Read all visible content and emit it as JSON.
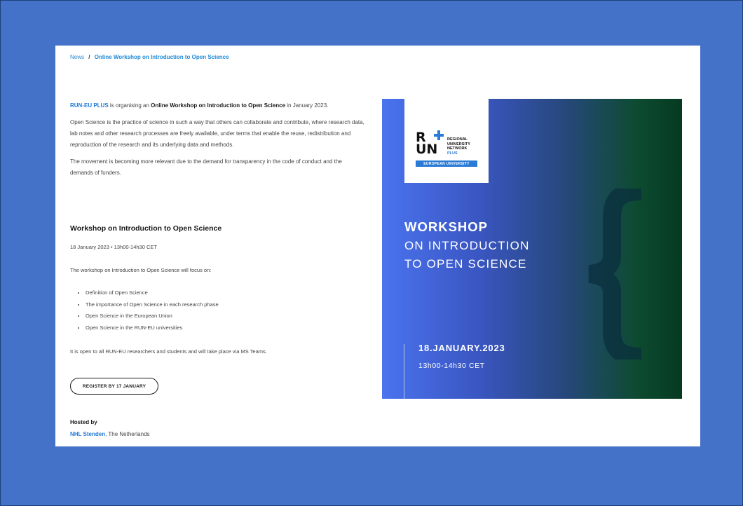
{
  "breadcrumb": {
    "parent": "News",
    "separator": "/",
    "current": "Online Workshop on Introduction to Open Science"
  },
  "intro": {
    "org": "RUN-EU PLUS",
    "text1": " is organising an ",
    "event": "Online Workshop on Introduction to Open Science",
    "text2": " in January 2023."
  },
  "paragraphs": [
    "Open Science is the practice of science in such a way that others can collaborate and contribute, where research data, lab notes and other research processes are freely available, under terms that enable the reuse, redistribution and reproduction of the research and its underlying data and methods.",
    "The movement is becoming more relevant due to the demand for transparency in the code of conduct and the demands of funders."
  ],
  "section": {
    "title": "Workshop on Introduction to Open Science",
    "date": "18 January 2023 • 13h00-14h30 CET",
    "focus_intro": "The workshop on Introduction to Open Science will focus on:",
    "bullets": [
      "Definition of Open Science",
      "The importance of Open Science in each research phase",
      "Open Science in the European Union",
      "Open Science in the RUN-EU universities"
    ],
    "open_text": "It is open to all RUN-EU researchers and students and will take place via MS Teams."
  },
  "register_button": "REGISTER BY 17 JANUARY",
  "hosted": {
    "label": "Hosted by",
    "host": "NHL Stenden",
    "location": ", The Netherlands"
  },
  "banner": {
    "logo": {
      "letters_top": "R",
      "letters_bottom": "UN",
      "line1": "REGIONAL",
      "line2": "UNIVERSITY",
      "line3": "NETWORK",
      "line4": "PLUS",
      "bar": "EUROPEAN UNIVERSITY"
    },
    "title_line1": "WORKSHOP",
    "title_line2": "ON INTRODUCTION",
    "title_line3": "TO OPEN SCIENCE",
    "date": "18.JANUARY.2023",
    "time": "13h00-14h30 CET",
    "colors": {
      "start": "#4a73ee",
      "end": "#053a21"
    }
  },
  "colors": {
    "page_bg": "#4472c8",
    "link": "#1f7ad6"
  }
}
